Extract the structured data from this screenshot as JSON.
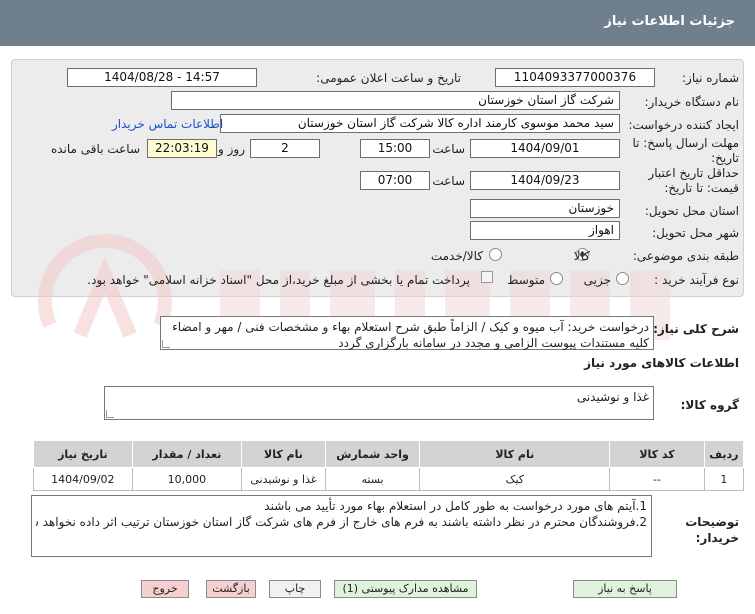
{
  "header": {
    "title": "جزئیات اطلاعات نیاز"
  },
  "form": {
    "need_number_label": "شماره نیاز:",
    "need_number": "1104093377000376",
    "announce_label": "تاریخ و ساعت اعلان عمومی:",
    "announce_value": "1404/08/28 - 14:57",
    "buyer_org_label": "نام دستگاه خریدار:",
    "buyer_org": "شرکت گاز استان خوزستان",
    "creator_label": "ایجاد کننده درخواست:",
    "creator": "سید محمد موسوی کارمند اداره کالا شرکت گاز استان خوزستان",
    "contact_link": "اطلاعات تماس خریدار",
    "deadline_label": "مهلت ارسال پاسخ: تا تاریخ:",
    "deadline_date": "1404/09/01",
    "time_label": "ساعت",
    "deadline_time": "15:00",
    "days_value": "2",
    "days_label": "روز و",
    "remaining_value": "22:03:19",
    "remaining_label": "ساعت باقی مانده",
    "validity_label": "حداقل تاریخ اعتبار قیمت: تا تاریخ:",
    "validity_date": "1404/09/23",
    "validity_time": "07:00",
    "province_label": "استان محل تحویل:",
    "province": "خوزستان",
    "city_label": "شهر محل تحویل:",
    "city": "اهواز",
    "category_label": "طبقه بندی موضوعی:",
    "category_options": [
      "کالا",
      "کالا/خدمت"
    ],
    "category_selected": "کالا",
    "process_label": "نوع فرآیند خرید :",
    "process_options": [
      "جزیی",
      "متوسط"
    ],
    "process_selected": "جزیی",
    "payment_note": "پرداخت تمام یا بخشی از مبلغ خرید،از محل \"اسناد خزانه اسلامی\" خواهد بود."
  },
  "description": {
    "label": "شرح کلی نیاز:",
    "text": "درخواست خرید: آب میوه و کیک / الزاماً طبق شرح استعلام بهاء و مشخصات فنی / مهر و امضاء کلیه مستندات پیوست الزامی و مجدد در سامانه بارگزاری گردد"
  },
  "goods": {
    "section_title": "اطلاعات کالاهای مورد نیاز",
    "group_label": "گروه کالا:",
    "group_value": "غذا و نوشیدنی",
    "columns": [
      "ردیف",
      "کد کالا",
      "نام کالا",
      "واحد شمارش",
      "نام کالا",
      "تعداد / مقدار",
      "تاریخ نیاز"
    ],
    "rows": [
      [
        "1",
        "--",
        "کیک",
        "بسته",
        "غذا و نوشیدنی",
        "10,000",
        "1404/09/02"
      ]
    ]
  },
  "notes": {
    "label": "توضیحات خریدار:",
    "line1": "1.آیتم های مورد درخواست به طور کامل در استعلام بهاء مورد تأیید می باشند",
    "line2": "2.فروشندگان محترم در نظر داشته باشند به فرم های خارج از فرم های شرکت گاز استان خوزستان ترتیب اثر داده نخواهد شد"
  },
  "buttons": {
    "reply": "پاسخ به نیاز",
    "attachments": "مشاهده مدارک پیوستی (1)",
    "print": "چاپ",
    "back": "بازگشت",
    "exit": "خروج"
  },
  "colors": {
    "header_bg": "#6f7f8c",
    "panel_bg": "#ececec",
    "link": "#1a52c6",
    "highlight": "#fffdd0"
  }
}
